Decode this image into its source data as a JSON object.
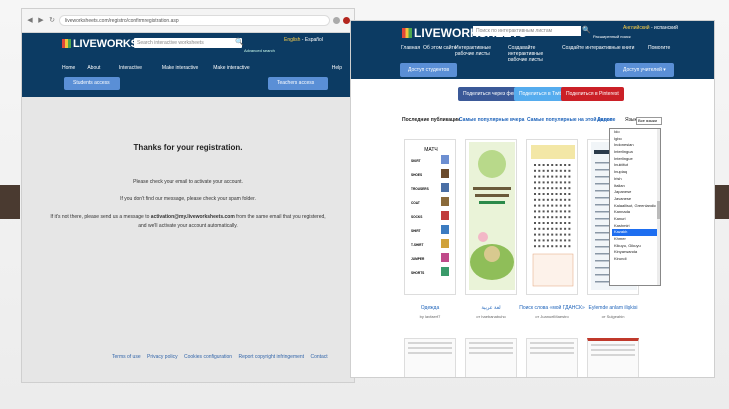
{
  "left_shot": {
    "browser": {
      "url": "liveworksheets.com/registro/confirmregistration.asp"
    },
    "header": {
      "logo": "LIVEWORKSHEETS",
      "search_placeholder": "Search interactive worksheets",
      "advanced_search": "Advanced search",
      "lang_active": "English",
      "lang_sep": "-",
      "lang_other": "Español"
    },
    "nav": [
      "Home",
      "About this site",
      "Interactive worksheets",
      "Make interactive worksheets",
      "Make interactive workbooks",
      "Help"
    ],
    "students_btn": "Students access",
    "teachers_btn": "Teachers access",
    "message": {
      "title": "Thanks for your registration.",
      "p1": "Please check your email to activate your account.",
      "p2": "If you don't find our message, please check your spam folder.",
      "p3_before": "If it's not there, please send us a message to ",
      "p3_email": "activation@my.liveworksheets.com",
      "p3_after": " from the same email that you registered,",
      "p4": "and we'll activate your account automatically."
    },
    "footer": [
      "Terms of use",
      "Privacy policy",
      "Cookies configuration",
      "Report copyright infringement",
      "Contact"
    ]
  },
  "right_shot": {
    "header": {
      "logo": "LIVEWORKSHEETS",
      "search_placeholder": "Поиск по интерактивным листам",
      "lang_active": "Английский",
      "lang_sep": "-",
      "lang_other": "испанский",
      "login_link": "Расширенный поиск"
    },
    "nav": [
      "Главная",
      "Об этом сайте",
      "Интерактивные рабочие листы",
      "Создавайте интерактивные рабочие листы",
      "Создайте интерактивные книги",
      "Помогите"
    ],
    "students_btn": "Доступ студентов",
    "teachers_btn": "Доступ учителей ▾",
    "share": {
      "facebook": "Поделиться через фейсбук",
      "twitter": "Поделиться в Twitter",
      "pinterest": "Поделиться в Pinterest"
    },
    "tabs": [
      "Последние публикации",
      "Самые популярные вчера",
      "Самые популярные на этой неделе",
      "Далее"
    ],
    "lang_filter_label": "Язык:",
    "lang_filter_value": "Все языки",
    "dropdown": {
      "items": [
        "Ido",
        "Igbo",
        "Indonesian",
        "Interlingua",
        "Interlingue",
        "Inuktitut",
        "Inupiaq",
        "Irish",
        "Italian",
        "Japanese",
        "Javanese",
        "Kalaallisut, Greenlandic",
        "Kannada",
        "Kanuri",
        "Kashmiri",
        "Kazakh",
        "Khmer",
        "Kikuyu, Gikuyu",
        "Kinyarwanda",
        "Kirundi"
      ],
      "selected": "Kazakh"
    },
    "cards": [
      {
        "title": "Одежда",
        "author": "by lavfaerf7",
        "thumb_heading": "МАТЧ"
      },
      {
        "title": "لغة عربية",
        "author": "от haebanabuho",
        "thumb_heading": ""
      },
      {
        "title": "Поиск слова «мой ГДАНСК»",
        "author": "от JuanuelMaestro",
        "thumb_heading": ""
      },
      {
        "title": "Eylemde anlam ilişkisi",
        "author": "от Sulgeahin",
        "thumb_heading": ""
      }
    ]
  },
  "clothing_words": [
    "SKIRT",
    "SHOES",
    "TROUSERS",
    "COAT",
    "SOCKS",
    "SHIRT",
    "T-SHIRT",
    "JUMPER",
    "SHORTS"
  ]
}
